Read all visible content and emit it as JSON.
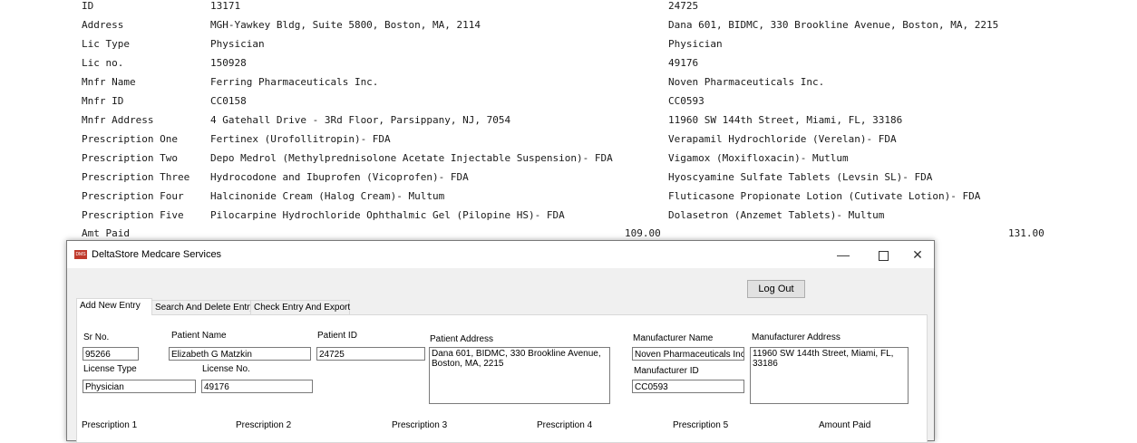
{
  "report": {
    "rows": [
      {
        "label": "ID",
        "value1": "13171",
        "value2": "24725"
      },
      {
        "label": "Address",
        "value1": "MGH-Yawkey Bldg, Suite 5800, Boston, MA, 2114",
        "value2": "Dana 601,  BIDMC, 330 Brookline Avenue, Boston, MA, 2215"
      },
      {
        "label": "Lic Type",
        "value1": "Physician",
        "value2": "Physician"
      },
      {
        "label": "Lic no.",
        "value1": "150928",
        "value2": "49176"
      },
      {
        "label": "Mnfr Name",
        "value1": "Ferring Pharmaceuticals Inc.",
        "value2": "Noven Pharmaceuticals Inc."
      },
      {
        "label": "Mnfr ID",
        "value1": "CC0158",
        "value2": "CC0593"
      },
      {
        "label": "Mnfr Address",
        "value1": "4 Gatehall Drive - 3Rd Floor, Parsippany, NJ, 7054",
        "value2": "11960 SW 144th Street, Miami, FL, 33186"
      },
      {
        "label": "Prescription One",
        "value1": "Fertinex (Urofollitropin)- FDA",
        "value2": "Verapamil Hydrochloride (Verelan)- FDA"
      },
      {
        "label": "Prescription Two",
        "value1": "Depo Medrol (Methylprednisolone Acetate Injectable Suspension)- FDA",
        "value2": "Vigamox (Moxifloxacin)- Mutlum"
      },
      {
        "label": "Prescription Three",
        "value1": "Hydrocodone and Ibuprofen (Vicoprofen)- FDA",
        "value2": "Hyoscyamine Sulfate Tablets (Levsin SL)- FDA"
      },
      {
        "label": "Prescription Four",
        "value1": "Halcinonide Cream (Halog Cream)- Multum",
        "value2": "Fluticasone Propionate Lotion (Cutivate Lotion)- FDA"
      },
      {
        "label": "Prescription Five",
        "value1": "Pilocarpine Hydrochloride Ophthalmic Gel (Pilopine HS)- FDA",
        "value2": "Dolasetron (Anzemet Tablets)- Multum"
      }
    ],
    "amt_label": "Amt Paid",
    "amt1": "109.00",
    "amt2": "131.00"
  },
  "window": {
    "icon_text": "DMS",
    "title": "DeltaStore Medcare Services",
    "minimize": "—",
    "close": "✕"
  },
  "logout_label": "Log Out",
  "tabs": [
    "Add New Entry",
    "Search And Delete Entry",
    "Check Entry And Export"
  ],
  "form": {
    "sr_no_label": "Sr No.",
    "sr_no": "95266",
    "patient_name_label": "Patient Name",
    "patient_name": "Elizabeth G Matzkin",
    "patient_id_label": "Patient ID",
    "patient_id": "24725",
    "patient_address_label": "Patient Address",
    "patient_address": "Dana 601, BIDMC, 330 Brookline Avenue, Boston, MA, 2215",
    "manufacturer_name_label": "Manufacturer Name",
    "manufacturer_name": "Noven Pharmaceuticals Inc.",
    "manufacturer_address_label": "Manufacturer Address",
    "manufacturer_address": "11960 SW 144th Street, Miami, FL, 33186",
    "license_type_label": "License Type",
    "license_type": "Physician",
    "license_no_label": "License No.",
    "license_no": "49176",
    "manufacturer_id_label": "Manufacturer ID",
    "manufacturer_id": "CC0593",
    "prescription1_label": "Prescription 1",
    "prescription2_label": "Prescription 2",
    "prescription3_label": "Prescription 3",
    "prescription4_label": "Prescription 4",
    "prescription5_label": "Prescription 5",
    "amount_paid_label": "Amount Paid"
  }
}
